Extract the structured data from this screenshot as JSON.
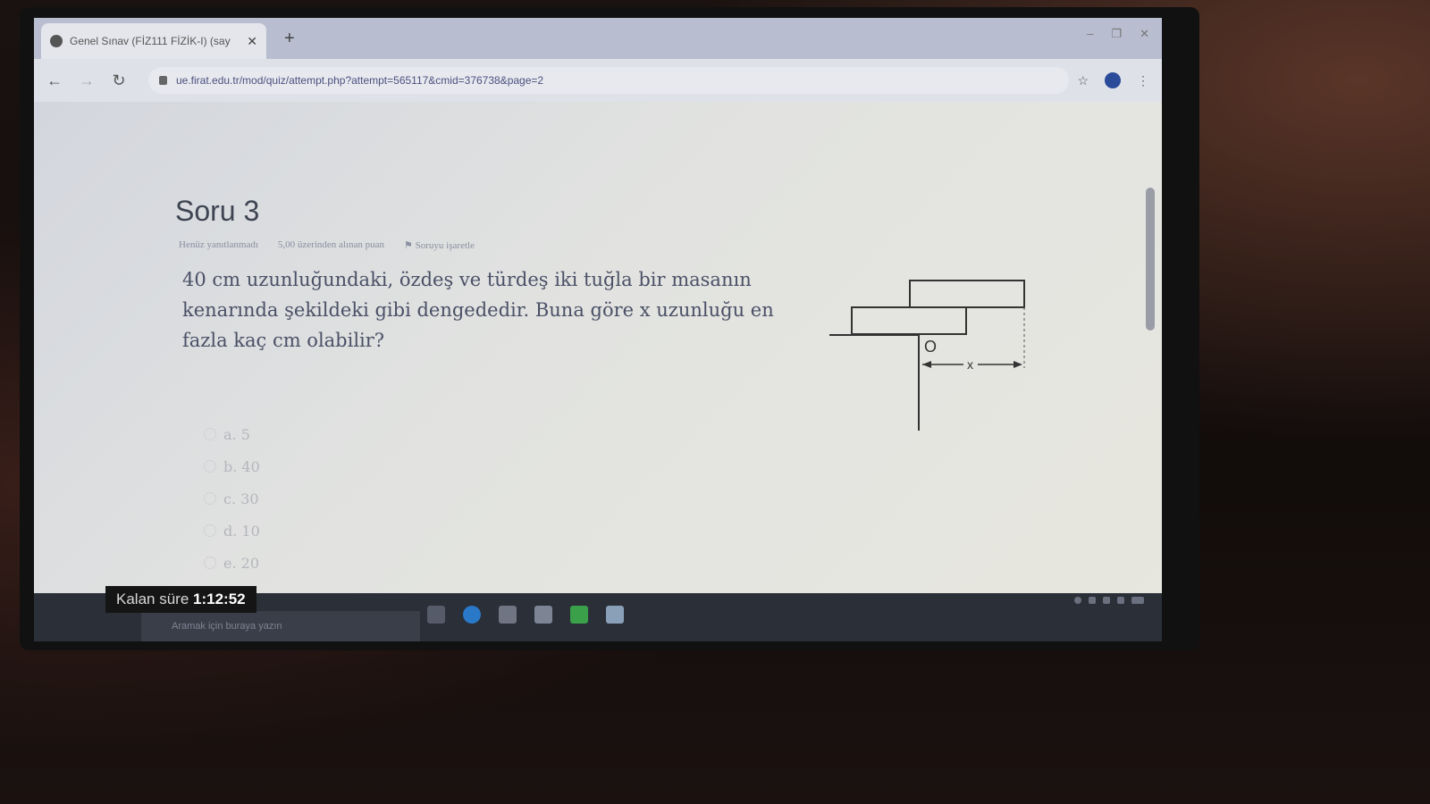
{
  "browser": {
    "tab_title": "Genel Sınav (FİZ111 FİZİK-I) (say",
    "url": "ue.firat.edu.tr/mod/quiz/attempt.php?attempt=565117&cmid=376738&page=2"
  },
  "question": {
    "title": "Soru 3",
    "status": "Henüz yanıtlanmadı",
    "points": "5,00 üzerinden alınan puan",
    "flag": "Soruyu işaretle",
    "text": "40 cm uzunluğundaki, özdeş ve türdeş iki tuğla bir masanın kenarında şekildeki gibi dengededir. Buna göre x uzunluğu en fazla kaç cm olabilir?",
    "figure_labels": {
      "pivot": "O",
      "x": "x"
    }
  },
  "answers": [
    {
      "label": "a. 5"
    },
    {
      "label": "b. 40"
    },
    {
      "label": "c. 30"
    },
    {
      "label": "d. 10"
    },
    {
      "label": "e. 20"
    }
  ],
  "timer": {
    "label": "Kalan süre",
    "value": "1:12:52"
  },
  "taskbar": {
    "search_placeholder": "Aramak için buraya yazın"
  }
}
